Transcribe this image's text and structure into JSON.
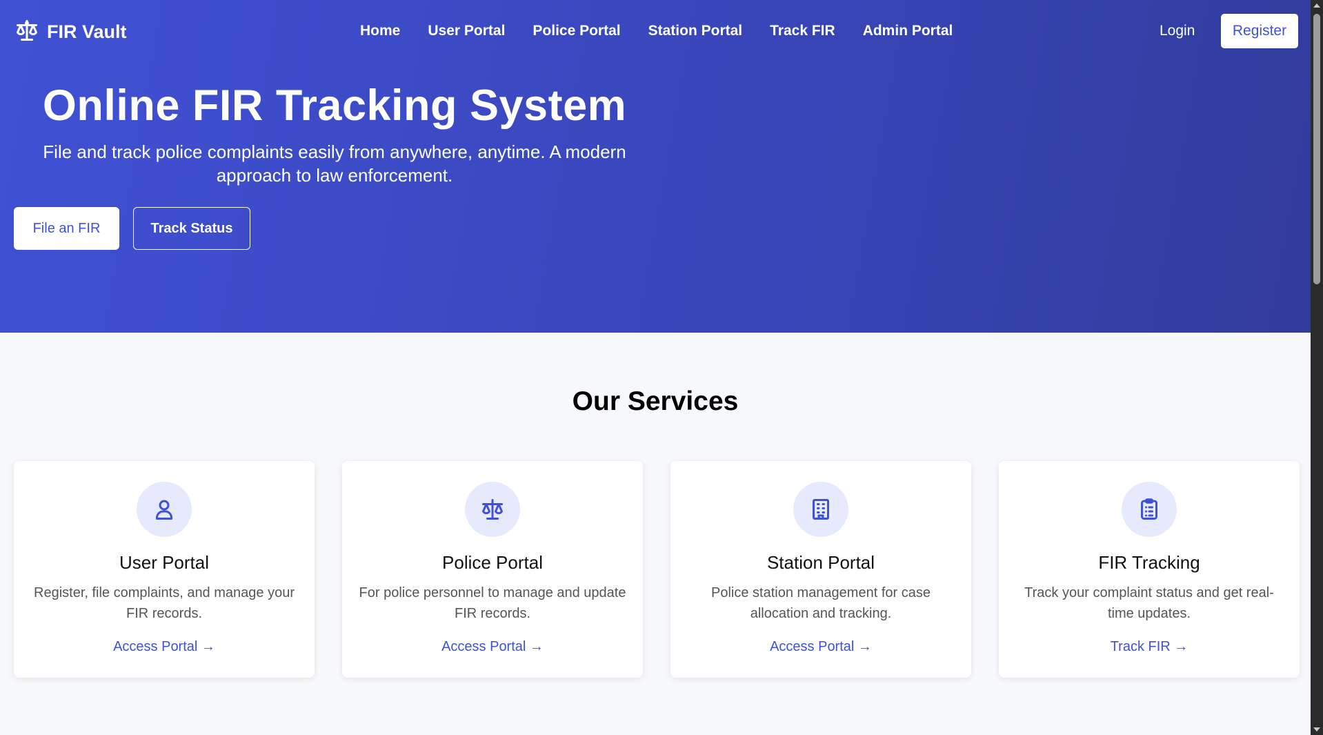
{
  "brand": {
    "name": "FIR Vault",
    "icon": "scales-icon"
  },
  "nav": {
    "links": [
      "Home",
      "User Portal",
      "Police Portal",
      "Station Portal",
      "Track FIR",
      "Admin Portal"
    ],
    "login": "Login",
    "register": "Register"
  },
  "hero": {
    "title": "Online FIR Tracking System",
    "subtitle": "File and track police complaints easily from anywhere, anytime. A modern approach to law enforcement.",
    "primary_button": "File an FIR",
    "secondary_button": "Track Status"
  },
  "services": {
    "title": "Our Services",
    "cards": [
      {
        "icon": "user-icon",
        "title": "User Portal",
        "description": "Register, file complaints, and manage your FIR records.",
        "link": "Access Portal →"
      },
      {
        "icon": "scales-icon",
        "title": "Police Portal",
        "description": "For police personnel to manage and update FIR records.",
        "link": "Access Portal →"
      },
      {
        "icon": "building-icon",
        "title": "Station Portal",
        "description": "Police station management for case allocation and tracking.",
        "link": "Access Portal →"
      },
      {
        "icon": "clipboard-icon",
        "title": "FIR Tracking",
        "description": "Track your complaint status and get real-time updates.",
        "link": "Track FIR →"
      }
    ]
  },
  "colors": {
    "accent": "#3f51d4",
    "hero_start": "#3f51d4",
    "hero_end": "#313c9c",
    "icon_bg": "#e6eafc"
  }
}
